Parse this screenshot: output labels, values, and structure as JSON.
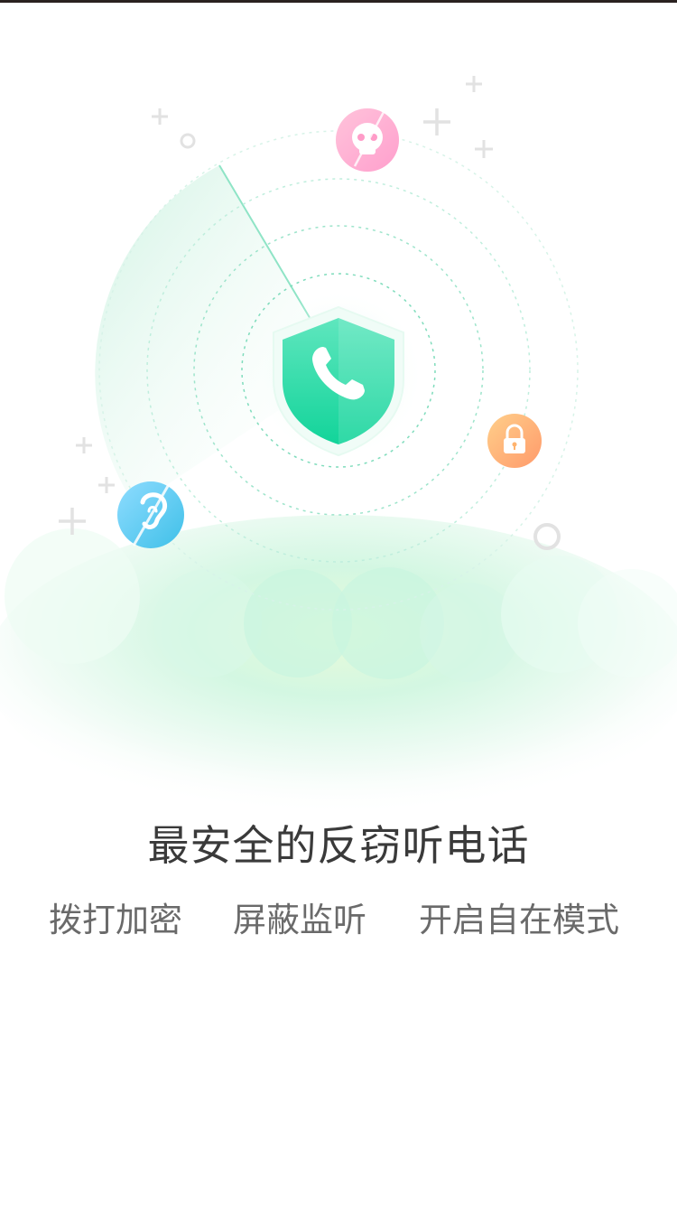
{
  "onboarding": {
    "headline": "最安全的反窃听电话",
    "features": [
      "拨打加密",
      "屏蔽监听",
      "开启自在模式"
    ]
  },
  "illustration": {
    "center_icon": "shield-phone-icon",
    "orbit_icons": [
      "skull-icon",
      "lock-icon",
      "ear-blocked-icon"
    ],
    "colors": {
      "shield": "#1ed8a0",
      "radar": "#c8f2e2",
      "skull_badge": "#ff9cc8",
      "lock_badge": "#ffb36e",
      "ear_badge": "#5cc8f0",
      "headline_text": "#3a3a3a",
      "feature_text": "#6a6a6a"
    }
  }
}
